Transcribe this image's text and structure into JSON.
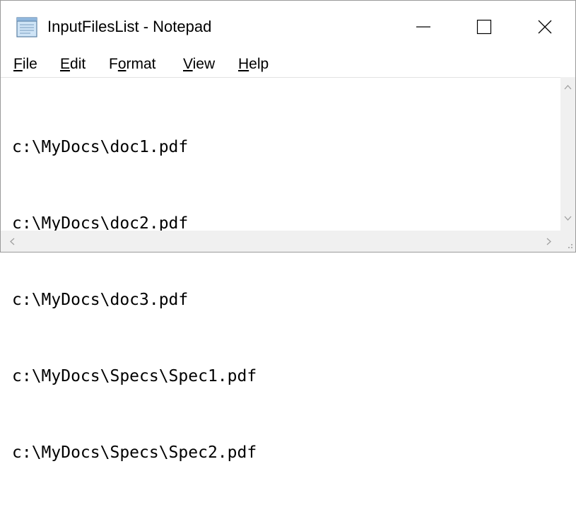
{
  "window": {
    "title": "InputFilesList - Notepad",
    "icons": {
      "app": "notepad-icon",
      "minimize": "minimize-icon",
      "maximize": "maximize-icon",
      "close": "close-icon"
    }
  },
  "menu": {
    "items": [
      {
        "mnemonic": "F",
        "rest": "ile"
      },
      {
        "mnemonic": "E",
        "rest": "dit"
      },
      {
        "pre": "F",
        "mnemonic": "o",
        "rest": "rmat"
      },
      {
        "mnemonic": "V",
        "rest": "iew"
      },
      {
        "mnemonic": "H",
        "rest": "elp"
      }
    ]
  },
  "editor": {
    "lines": [
      "c:\\MyDocs\\doc1.pdf",
      "c:\\MyDocs\\doc2.pdf",
      "c:\\MyDocs\\doc3.pdf",
      "c:\\MyDocs\\Specs\\Spec1.pdf",
      "c:\\MyDocs\\Specs\\Spec2.pdf"
    ]
  },
  "scrollbars": {
    "icons": [
      "scroll-up-icon",
      "scroll-down-icon",
      "scroll-left-icon",
      "scroll-right-icon",
      "resize-grip-icon"
    ]
  }
}
